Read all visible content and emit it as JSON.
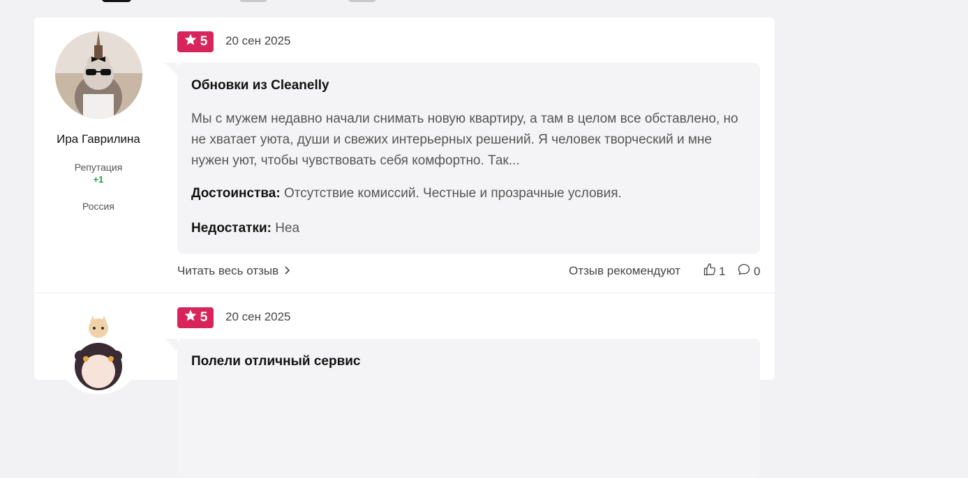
{
  "reviews": [
    {
      "author": {
        "name": "Ира Гаврилина",
        "reputation_label": "Репутация",
        "reputation_value": "+1",
        "country": "Россия"
      },
      "rating": "5",
      "date": "20 сен 2025",
      "title": "Обновки из Cleanelly",
      "text": "Мы с мужем недавно начали снимать новую квартиру, а там в целом все обставлено, но не хватает уюта, души и свежих интерьерных решений. Я человек творческий и мне нужен уют, чтобы чувствовать себя комфортно. Так...",
      "pros_label": "Достоинства:",
      "pros": "Отсутствие комиссий. Честные и прозрачные условия.",
      "cons_label": "Недостатки:",
      "cons": "Неа",
      "read_more": "Читать весь отзыв",
      "recommend_label": "Отзыв рекомендуют",
      "likes": "1",
      "comments": "0"
    },
    {
      "rating": "5",
      "date": "20 сен 2025",
      "title": "Полели отличный сервис"
    }
  ],
  "colors": {
    "rating_badge": "#d7245a",
    "reputation": "#1aa33b",
    "bubble": "#f4f4f6"
  },
  "icons": [
    "star-icon",
    "chevron-right-icon",
    "thumbs-up-icon",
    "comment-icon"
  ]
}
